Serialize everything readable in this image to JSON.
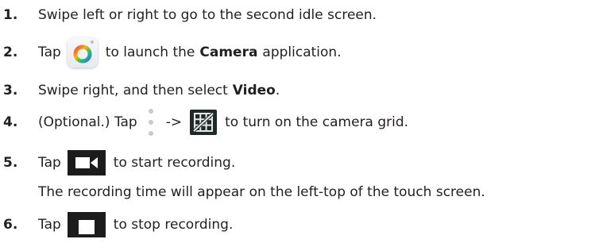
{
  "steps": [
    {
      "number": "1.",
      "text": "Swipe left or right to go to the second idle screen."
    },
    {
      "number": "2.",
      "before": "Tap",
      "icon": "camera-app-icon",
      "after": "to launch the",
      "bold": "Camera",
      "tail": "application."
    },
    {
      "number": "3.",
      "before": "Swipe right, and then select",
      "bold": "Video",
      "tail": "."
    },
    {
      "number": "4.",
      "before": "(Optional.) Tap",
      "icon1": "more-options-icon",
      "arrow": "->",
      "icon2": "grid-icon",
      "after": "to turn on the camera grid."
    },
    {
      "number": "5.",
      "before": "Tap",
      "icon": "video-record-icon",
      "after": "to start recording.",
      "note": "The recording time will appear on the left-top of the touch screen."
    },
    {
      "number": "6.",
      "before": "Tap",
      "icon": "stop-recording-icon",
      "after": "to stop recording."
    }
  ],
  "colors": {
    "text": "#231f20",
    "icon_dark": "#1c1c1c",
    "grid_bg": "#1f2a28"
  }
}
